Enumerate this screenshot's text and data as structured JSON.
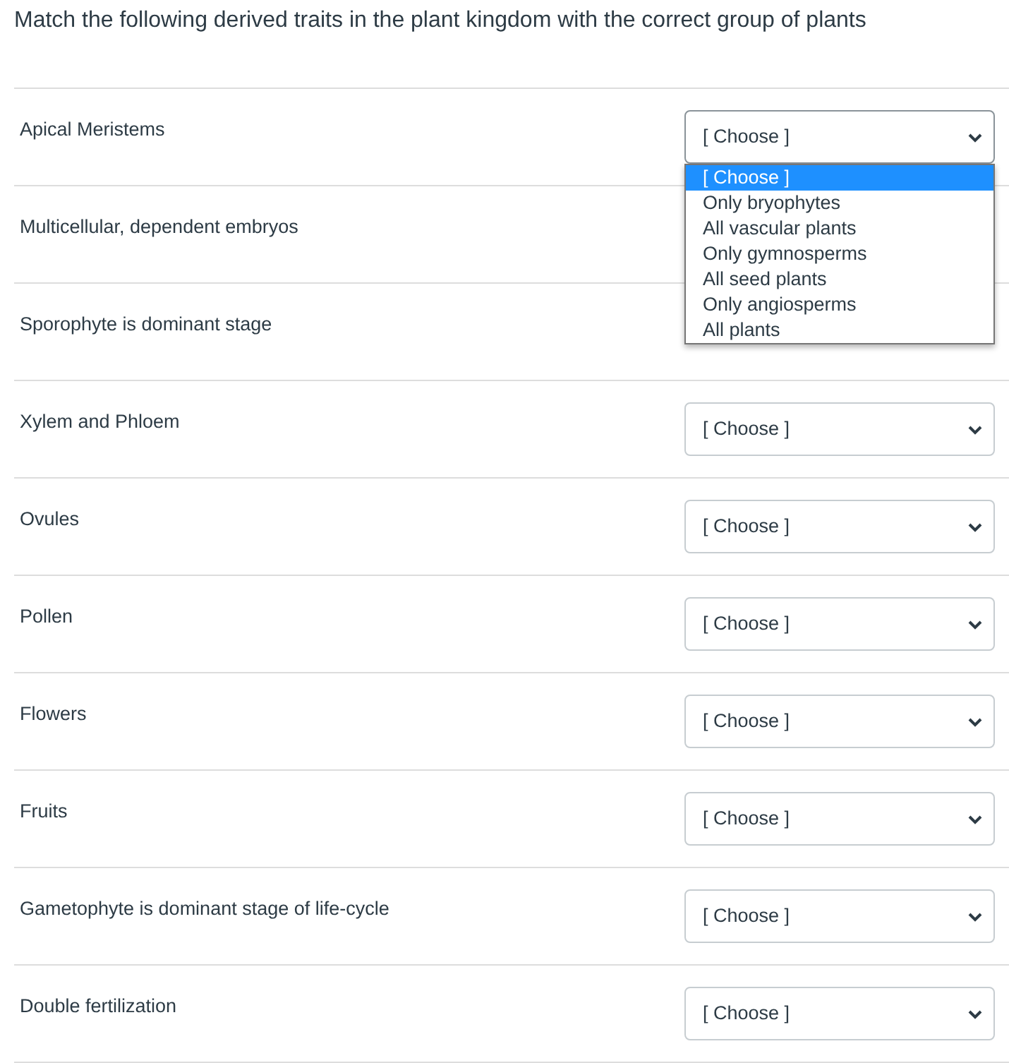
{
  "question": "Match the following derived traits in the plant kingdom with the correct group of plants",
  "rows": [
    {
      "label": "Apical Meristems",
      "select": {
        "value": "[ Choose ]",
        "expanded": true,
        "options": [
          {
            "label": "[ Choose ]",
            "selected": true
          },
          {
            "label": "Only bryophytes",
            "selected": false
          },
          {
            "label": "All vascular plants",
            "selected": false
          },
          {
            "label": "Only gymnosperms",
            "selected": false
          },
          {
            "label": "All seed plants",
            "selected": false
          },
          {
            "label": "Only angiosperms",
            "selected": false
          },
          {
            "label": "All plants",
            "selected": false
          }
        ]
      }
    },
    {
      "label": "Multicellular, dependent embryos"
    },
    {
      "label": "Sporophyte is dominant stage"
    },
    {
      "label": "Xylem and Phloem",
      "select": {
        "value": "[ Choose ]",
        "expanded": false
      }
    },
    {
      "label": "Ovules",
      "select": {
        "value": "[ Choose ]",
        "expanded": false
      }
    },
    {
      "label": "Pollen",
      "select": {
        "value": "[ Choose ]",
        "expanded": false
      }
    },
    {
      "label": "Flowers",
      "select": {
        "value": "[ Choose ]",
        "expanded": false
      }
    },
    {
      "label": "Fruits",
      "select": {
        "value": "[ Choose ]",
        "expanded": false
      }
    },
    {
      "label": "Gametophyte is dominant stage of life-cycle",
      "select": {
        "value": "[ Choose ]",
        "expanded": false
      }
    },
    {
      "label": "Double fertilization",
      "select": {
        "value": "[ Choose ]",
        "expanded": false
      }
    }
  ]
}
